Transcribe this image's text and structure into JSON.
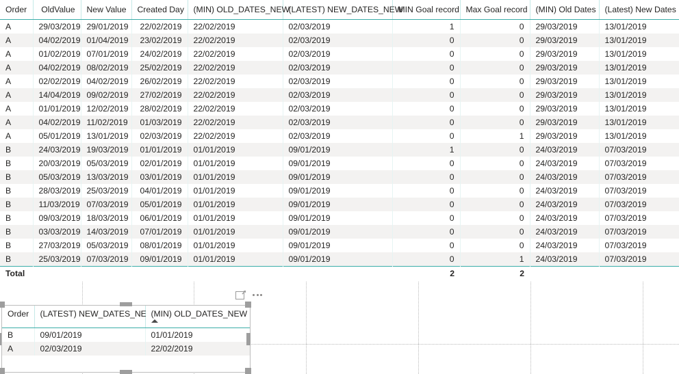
{
  "main_visual": {
    "name": "table-visual-detail",
    "columns": [
      {
        "label": "Order",
        "align": "txt",
        "width": 48
      },
      {
        "label": "OldValue",
        "align": "num",
        "width": 70
      },
      {
        "label": "New Value",
        "align": "num",
        "width": 74
      },
      {
        "label": "Created Day",
        "align": "num",
        "width": 82
      },
      {
        "label": "(MIN) OLD_DATES_NEW",
        "align": "txt",
        "width": 139
      },
      {
        "label": "(LATEST) NEW_DATES_NEW",
        "align": "txt",
        "width": 160
      },
      {
        "label": "MIN Goal record",
        "align": "num",
        "width": 99
      },
      {
        "label": "Max Goal record",
        "align": "num",
        "width": 102
      },
      {
        "label": "(MIN) Old Dates",
        "align": "txt",
        "width": 101
      },
      {
        "label": "(Latest) New Dates",
        "align": "txt",
        "width": 117
      }
    ],
    "rows": [
      [
        "A",
        "29/03/2019",
        "29/01/2019",
        "22/02/2019",
        "22/02/2019",
        "02/03/2019",
        "1",
        "0",
        "29/03/2019",
        "13/01/2019"
      ],
      [
        "A",
        "04/02/2019",
        "01/04/2019",
        "23/02/2019",
        "22/02/2019",
        "02/03/2019",
        "0",
        "0",
        "29/03/2019",
        "13/01/2019"
      ],
      [
        "A",
        "01/02/2019",
        "07/01/2019",
        "24/02/2019",
        "22/02/2019",
        "02/03/2019",
        "0",
        "0",
        "29/03/2019",
        "13/01/2019"
      ],
      [
        "A",
        "04/02/2019",
        "08/02/2019",
        "25/02/2019",
        "22/02/2019",
        "02/03/2019",
        "0",
        "0",
        "29/03/2019",
        "13/01/2019"
      ],
      [
        "A",
        "02/02/2019",
        "04/02/2019",
        "26/02/2019",
        "22/02/2019",
        "02/03/2019",
        "0",
        "0",
        "29/03/2019",
        "13/01/2019"
      ],
      [
        "A",
        "14/04/2019",
        "09/02/2019",
        "27/02/2019",
        "22/02/2019",
        "02/03/2019",
        "0",
        "0",
        "29/03/2019",
        "13/01/2019"
      ],
      [
        "A",
        "01/01/2019",
        "12/02/2019",
        "28/02/2019",
        "22/02/2019",
        "02/03/2019",
        "0",
        "0",
        "29/03/2019",
        "13/01/2019"
      ],
      [
        "A",
        "04/02/2019",
        "11/02/2019",
        "01/03/2019",
        "22/02/2019",
        "02/03/2019",
        "0",
        "0",
        "29/03/2019",
        "13/01/2019"
      ],
      [
        "A",
        "05/01/2019",
        "13/01/2019",
        "02/03/2019",
        "22/02/2019",
        "02/03/2019",
        "0",
        "1",
        "29/03/2019",
        "13/01/2019"
      ],
      [
        "B",
        "24/03/2019",
        "19/03/2019",
        "01/01/2019",
        "01/01/2019",
        "09/01/2019",
        "1",
        "0",
        "24/03/2019",
        "07/03/2019"
      ],
      [
        "B",
        "20/03/2019",
        "05/03/2019",
        "02/01/2019",
        "01/01/2019",
        "09/01/2019",
        "0",
        "0",
        "24/03/2019",
        "07/03/2019"
      ],
      [
        "B",
        "05/03/2019",
        "13/03/2019",
        "03/01/2019",
        "01/01/2019",
        "09/01/2019",
        "0",
        "0",
        "24/03/2019",
        "07/03/2019"
      ],
      [
        "B",
        "28/03/2019",
        "25/03/2019",
        "04/01/2019",
        "01/01/2019",
        "09/01/2019",
        "0",
        "0",
        "24/03/2019",
        "07/03/2019"
      ],
      [
        "B",
        "11/03/2019",
        "07/03/2019",
        "05/01/2019",
        "01/01/2019",
        "09/01/2019",
        "0",
        "0",
        "24/03/2019",
        "07/03/2019"
      ],
      [
        "B",
        "09/03/2019",
        "18/03/2019",
        "06/01/2019",
        "01/01/2019",
        "09/01/2019",
        "0",
        "0",
        "24/03/2019",
        "07/03/2019"
      ],
      [
        "B",
        "03/03/2019",
        "14/03/2019",
        "07/01/2019",
        "01/01/2019",
        "09/01/2019",
        "0",
        "0",
        "24/03/2019",
        "07/03/2019"
      ],
      [
        "B",
        "27/03/2019",
        "05/03/2019",
        "08/01/2019",
        "01/01/2019",
        "09/01/2019",
        "0",
        "0",
        "24/03/2019",
        "07/03/2019"
      ],
      [
        "B",
        "25/03/2019",
        "07/03/2019",
        "09/01/2019",
        "01/01/2019",
        "09/01/2019",
        "0",
        "1",
        "24/03/2019",
        "07/03/2019"
      ]
    ],
    "total_row": [
      "Total",
      "",
      "",
      "",
      "",
      "",
      "2",
      "2",
      "",
      ""
    ]
  },
  "second_visual": {
    "name": "table-visual-summary",
    "selected": true,
    "columns": [
      {
        "label": "Order",
        "width": 47,
        "sorted": false
      },
      {
        "label": "(LATEST) NEW_DATES_NEW",
        "width": 162,
        "sorted": false
      },
      {
        "label": "(MIN) OLD_DATES_NEW",
        "width": 153,
        "sorted": true
      }
    ],
    "sort_indicator": "ascending-sort-arrow",
    "rows": [
      [
        "B",
        "09/01/2019",
        "01/01/2019"
      ],
      [
        "A",
        "02/03/2019",
        "22/02/2019"
      ]
    ]
  },
  "visual_header_icons": {
    "focus_mode": "focus-mode-icon",
    "more_options": "more-options-icon"
  },
  "colors": {
    "header_underline": "#3aada8",
    "grid_line": "#e6f4f3",
    "alt_row": "#f3f2f1",
    "text": "#252423",
    "selection_border": "#bcbcbc",
    "handle": "#9e9e9e"
  }
}
